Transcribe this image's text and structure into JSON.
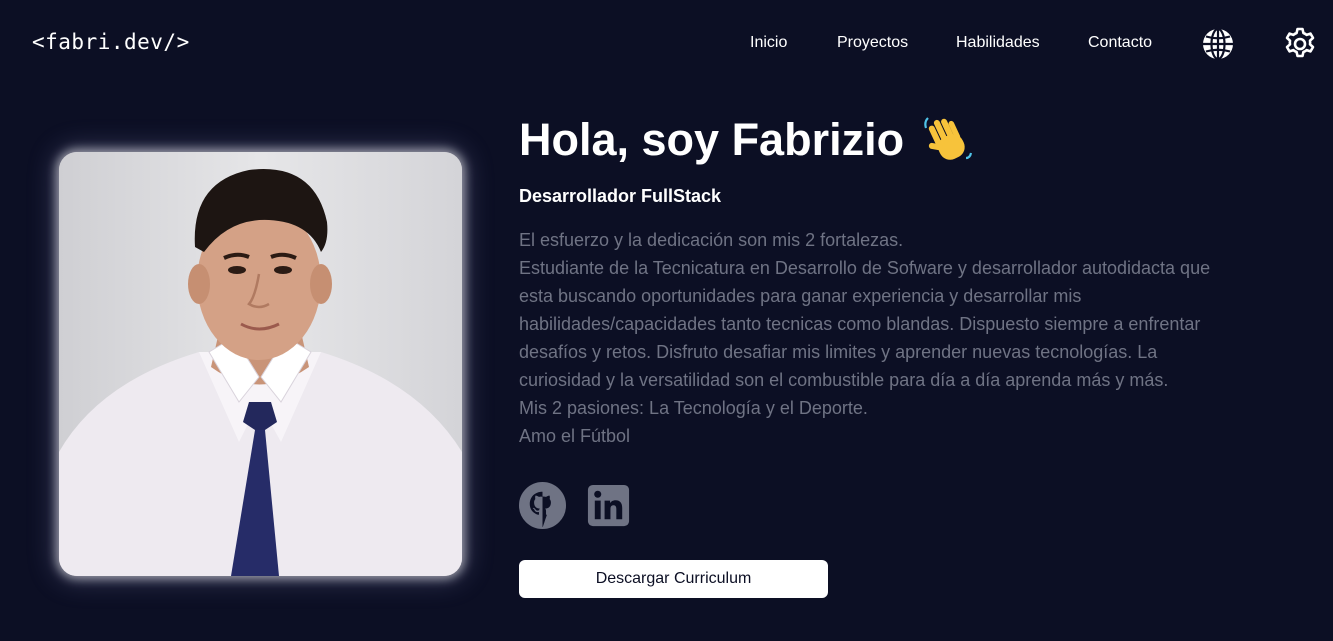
{
  "header": {
    "logo": "<fabri.dev/>",
    "nav": [
      {
        "label": "Inicio"
      },
      {
        "label": "Proyectos"
      },
      {
        "label": "Habilidades"
      },
      {
        "label": "Contacto"
      }
    ],
    "icons": [
      "globe-icon",
      "gear-icon"
    ]
  },
  "hero": {
    "title": "Hola, soy Fabrizio",
    "title_emoji": "waving-hand-icon",
    "role": "Desarrollador FullStack",
    "bio_lines": [
      "El esfuerzo y la dedicación son mis 2 fortalezas.",
      "Estudiante de la Tecnicatura en Desarrollo de Sofware y desarrollador autodidacta que",
      "esta buscando oportunidades para ganar experiencia y desarrollar mis",
      "habilidades/capacidades tanto tecnicas como blandas. Dispuesto siempre a enfrentar",
      "desafíos y retos. Disfruto desafiar mis limites y aprender nuevas tecnologías. La",
      "curiosidad y la versatilidad son el combustible para día a día aprenda más y más.",
      "Mis 2 pasiones: La Tecnología y el Deporte.",
      "Amo el Fútbol"
    ],
    "socials": [
      "github-icon",
      "linkedin-icon"
    ],
    "cv_button": "Descargar Curriculum"
  },
  "colors": {
    "background": "#0c0f24",
    "text": "#ffffff",
    "muted_text": "#6f7384",
    "button_bg": "#ffffff"
  }
}
